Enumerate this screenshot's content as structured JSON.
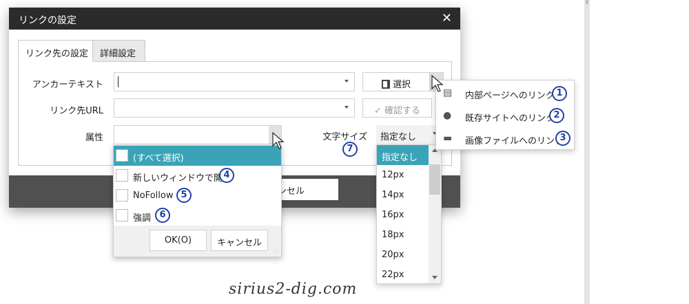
{
  "dialog": {
    "title": "リンクの設定",
    "close_glyph": "✕",
    "tabs": [
      {
        "label": "リンク先の設定",
        "active": true
      },
      {
        "label": "詳細設定",
        "active": false
      }
    ],
    "fields": {
      "anchor_label": "アンカーテキスト",
      "anchor_value": "",
      "url_label": "リンク先URL",
      "url_value": "",
      "attr_label": "属性",
      "size_label": "文字サイズ",
      "size_value": "指定なし"
    },
    "buttons": {
      "select_label": "選択",
      "confirm_label": "確認する",
      "confirm_glyph": "✓",
      "cancel_behind_label": "ンセル"
    }
  },
  "attribute_dropdown": {
    "items": [
      {
        "label": "(すべて選択)",
        "selected": true
      },
      {
        "label": "新しいウィンドウで開く",
        "marker": "4"
      },
      {
        "label": "NoFollow",
        "marker": "5"
      },
      {
        "label": "強調",
        "marker": "6"
      }
    ],
    "ok_label": "OK(O)",
    "cancel_label": "キャンセル"
  },
  "size_dropdown": {
    "options": [
      "指定なし",
      "12px",
      "14px",
      "16px",
      "18px",
      "20px",
      "22px"
    ],
    "selected": "指定なし",
    "marker": "7"
  },
  "link_menu": {
    "items": [
      {
        "label": "内部ページへのリンク",
        "icon": "pages-icon",
        "marker": "1"
      },
      {
        "label": "既存サイトへのリンク",
        "icon": "globe-icon",
        "marker": "2"
      },
      {
        "label": "画像ファイルへのリンク",
        "icon": "image-icon",
        "marker": "3"
      }
    ]
  },
  "colors": {
    "titlebar": "#2b2b2b",
    "selection": "#3aa3b8",
    "marker": "#1f3fa8"
  },
  "watermark": "sirius2-dig.com"
}
